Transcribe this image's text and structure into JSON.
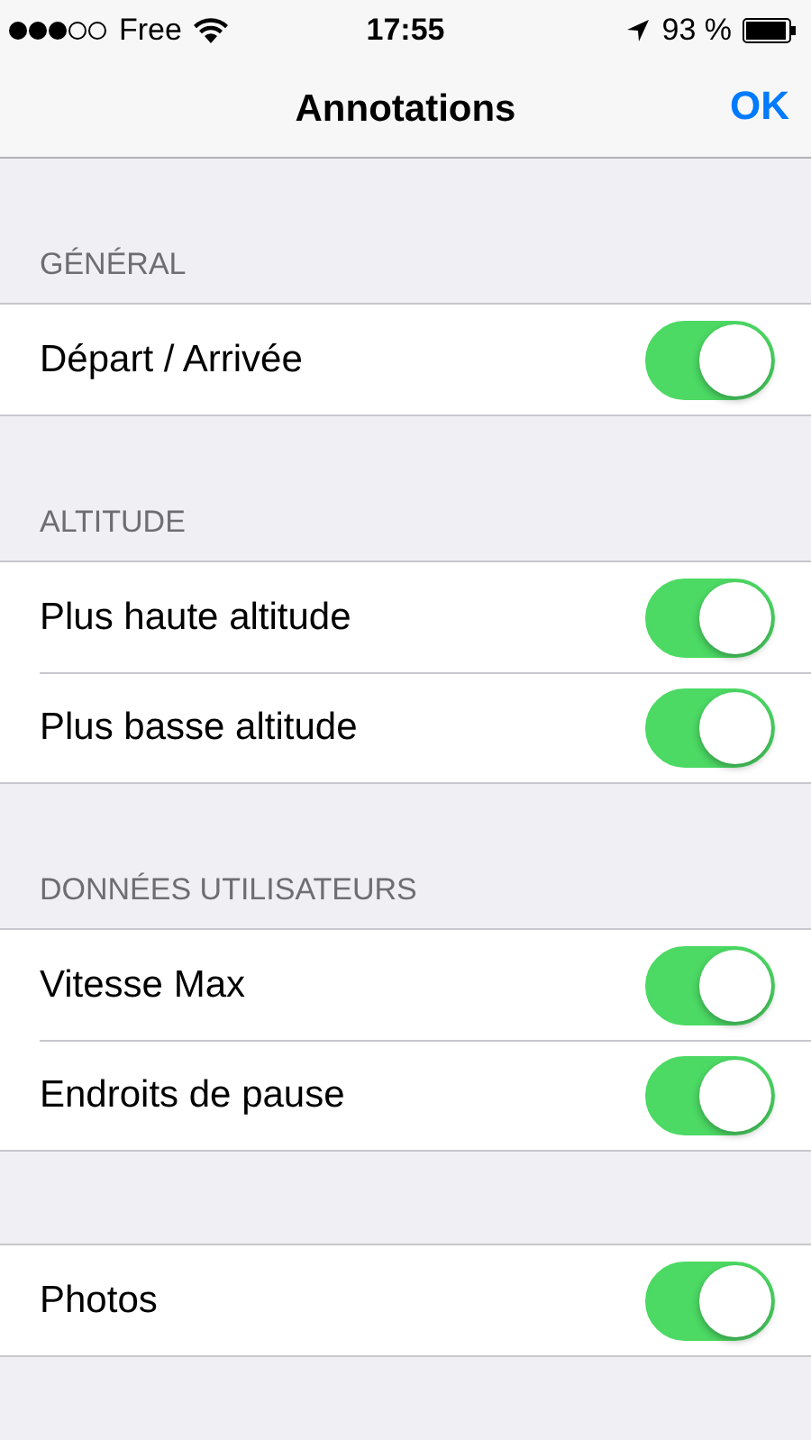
{
  "status_bar": {
    "carrier": "Free",
    "time": "17:55",
    "battery": "93 %"
  },
  "nav": {
    "title": "Annotations",
    "action": "OK"
  },
  "sections": [
    {
      "header": "GÉNÉRAL",
      "rows": [
        {
          "label": "Départ / Arrivée",
          "on": true
        }
      ]
    },
    {
      "header": "ALTITUDE",
      "rows": [
        {
          "label": "Plus haute altitude",
          "on": true
        },
        {
          "label": "Plus basse altitude",
          "on": true
        }
      ]
    },
    {
      "header": "DONNÉES UTILISATEURS",
      "rows": [
        {
          "label": "Vitesse Max",
          "on": true
        },
        {
          "label": "Endroits de pause",
          "on": true
        }
      ]
    },
    {
      "rows": [
        {
          "label": "Photos",
          "on": true
        }
      ]
    }
  ]
}
